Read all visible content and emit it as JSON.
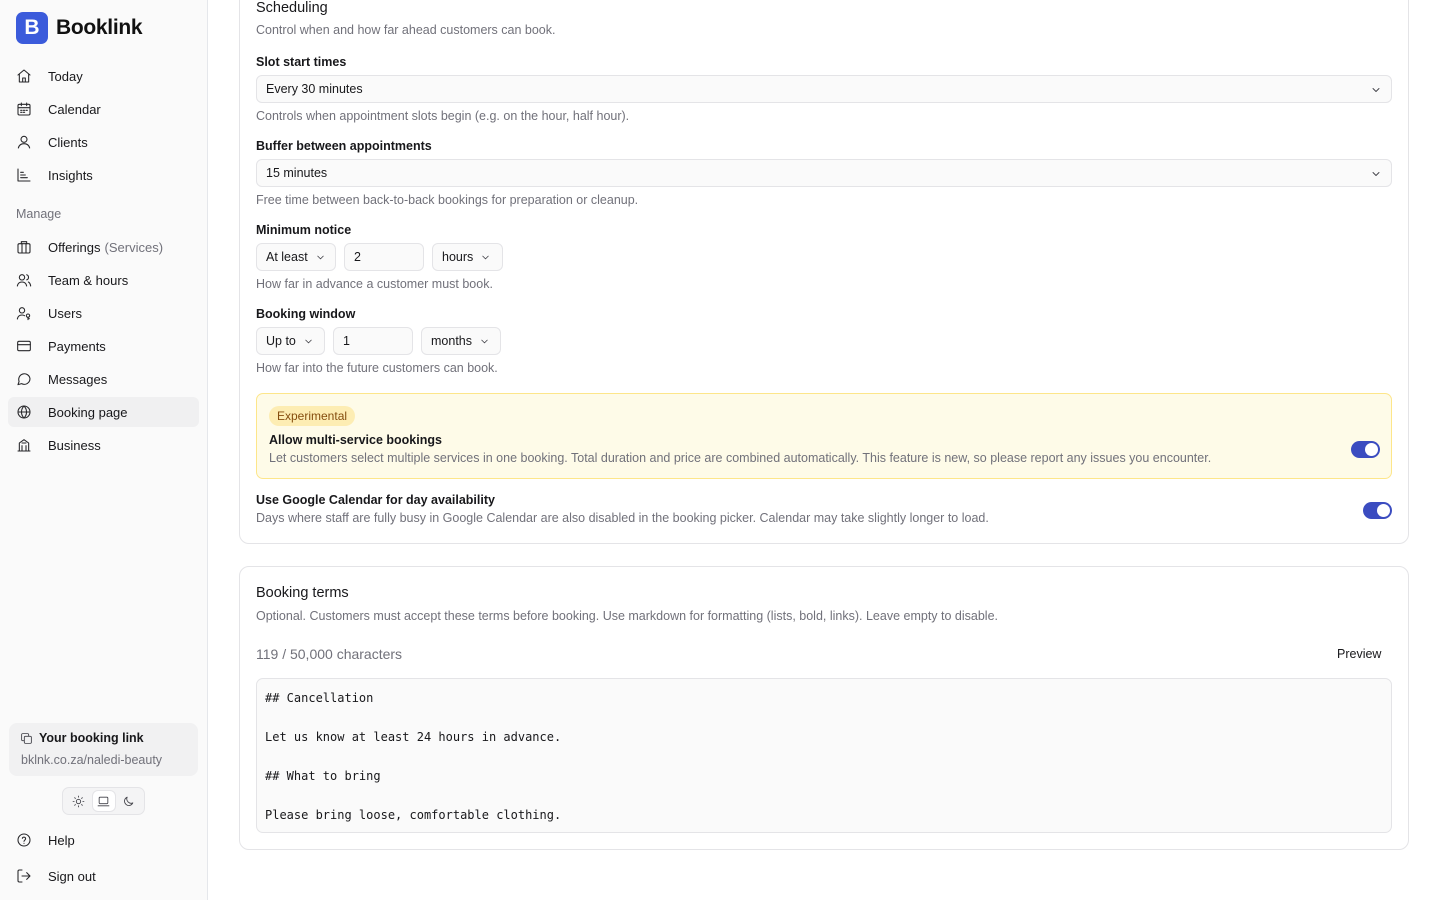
{
  "brand": {
    "logo_letter": "B",
    "name": "Booklink"
  },
  "nav": {
    "primary": [
      {
        "key": "today",
        "label": "Today",
        "icon": "home-icon"
      },
      {
        "key": "calendar",
        "label": "Calendar",
        "icon": "calendar-icon"
      },
      {
        "key": "clients",
        "label": "Clients",
        "icon": "user-icon"
      },
      {
        "key": "insights",
        "label": "Insights",
        "icon": "chart-icon"
      }
    ],
    "manage_title": "Manage",
    "manage": [
      {
        "key": "offerings",
        "label": "Offerings",
        "sub": "(Services)",
        "icon": "briefcase-icon"
      },
      {
        "key": "team-hours",
        "label": "Team & hours",
        "icon": "users-icon"
      },
      {
        "key": "users",
        "label": "Users",
        "icon": "user-key-icon"
      },
      {
        "key": "payments",
        "label": "Payments",
        "icon": "credit-card-icon"
      },
      {
        "key": "messages",
        "label": "Messages",
        "icon": "message-icon"
      },
      {
        "key": "booking-page",
        "label": "Booking page",
        "icon": "globe-icon",
        "active": true
      },
      {
        "key": "business",
        "label": "Business",
        "icon": "building-icon"
      }
    ],
    "footer": [
      {
        "key": "help",
        "label": "Help",
        "icon": "help-circle-icon"
      },
      {
        "key": "sign-out",
        "label": "Sign out",
        "icon": "sign-out-icon"
      }
    ]
  },
  "booking_link": {
    "title": "Your booking link",
    "url": "bklnk.co.za/naledi-beauty"
  },
  "theme": {
    "selected": "system",
    "options": [
      "light",
      "system",
      "dark"
    ]
  },
  "scheduling": {
    "title": "Scheduling",
    "description": "Control when and how far ahead customers can book.",
    "slot_start": {
      "label": "Slot start times",
      "value": "Every 30 minutes",
      "help": "Controls when appointment slots begin (e.g. on the hour, half hour)."
    },
    "buffer": {
      "label": "Buffer between appointments",
      "value": "15 minutes",
      "help": "Free time between back-to-back bookings for preparation or cleanup."
    },
    "min_notice": {
      "label": "Minimum notice",
      "qualifier": "At least",
      "amount": "2",
      "unit": "hours",
      "help": "How far in advance a customer must book."
    },
    "window": {
      "label": "Booking window",
      "qualifier": "Up to",
      "amount": "1",
      "unit": "months",
      "help": "How far into the future customers can book."
    },
    "multi_service": {
      "badge": "Experimental",
      "label": "Allow multi-service bookings",
      "help": "Let customers select multiple services in one booking. Total duration and price are combined automatically. This feature is new, so please report any issues you encounter.",
      "enabled": true
    },
    "google_calendar": {
      "label": "Use Google Calendar for day availability",
      "help": "Days where staff are fully busy in Google Calendar are also disabled in the booking picker. Calendar may take slightly longer to load.",
      "enabled": true
    }
  },
  "terms": {
    "title": "Booking terms",
    "description": "Optional. Customers must accept these terms before booking. Use markdown for formatting (lists, bold, links). Leave empty to disable.",
    "char_count": "119 / 50,000 characters",
    "preview_label": "Preview",
    "lines": [
      "## Cancellation",
      "",
      "Let us know at least 24 hours in advance.",
      "",
      "## What to bring",
      "",
      "Please bring loose, comfortable clothing."
    ]
  },
  "colors": {
    "brand": "#3b5bdb",
    "toggle_on": "#3b4cc0",
    "experimental_bg": "#fefbe8",
    "badge_bg": "#fdedb3"
  }
}
